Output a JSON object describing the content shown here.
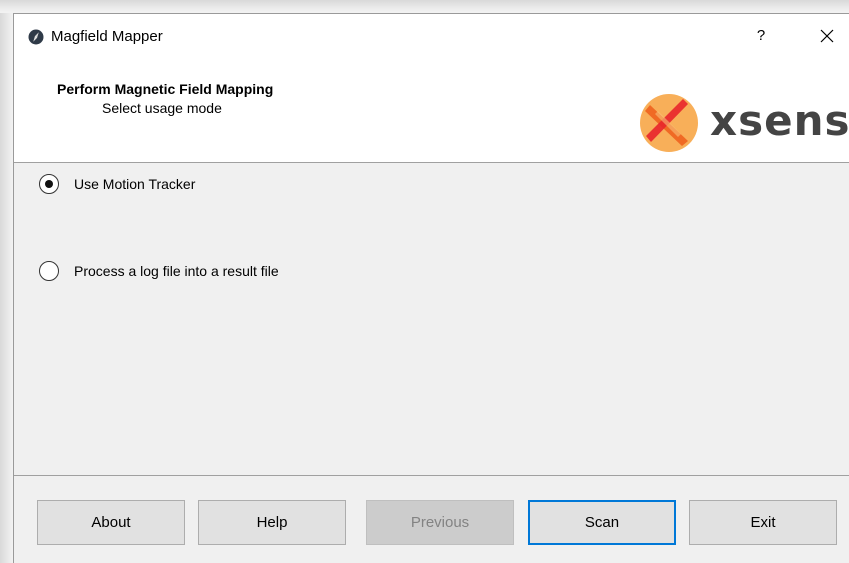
{
  "window": {
    "title": "Magfield Mapper",
    "help_label": "?",
    "app_icon": "compass-icon",
    "close_icon": "close-icon"
  },
  "header": {
    "title": "Perform Magnetic Field Mapping",
    "subtitle": "Select usage mode",
    "logo_text": "xsens",
    "logo_colors": [
      "#f47d20",
      "#e8262b"
    ]
  },
  "options": [
    {
      "label": "Use Motion Tracker",
      "selected": true
    },
    {
      "label": "Process a log file into a result file",
      "selected": false
    }
  ],
  "buttons": [
    {
      "label": "About",
      "enabled": true,
      "focused": false
    },
    {
      "label": "Help",
      "enabled": true,
      "focused": false
    },
    {
      "label": "Previous",
      "enabled": false,
      "focused": false
    },
    {
      "label": "Scan",
      "enabled": true,
      "focused": true
    },
    {
      "label": "Exit",
      "enabled": true,
      "focused": false
    }
  ],
  "colors": {
    "accent": "#0078d7",
    "dialog_background": "#f0f0f0"
  }
}
